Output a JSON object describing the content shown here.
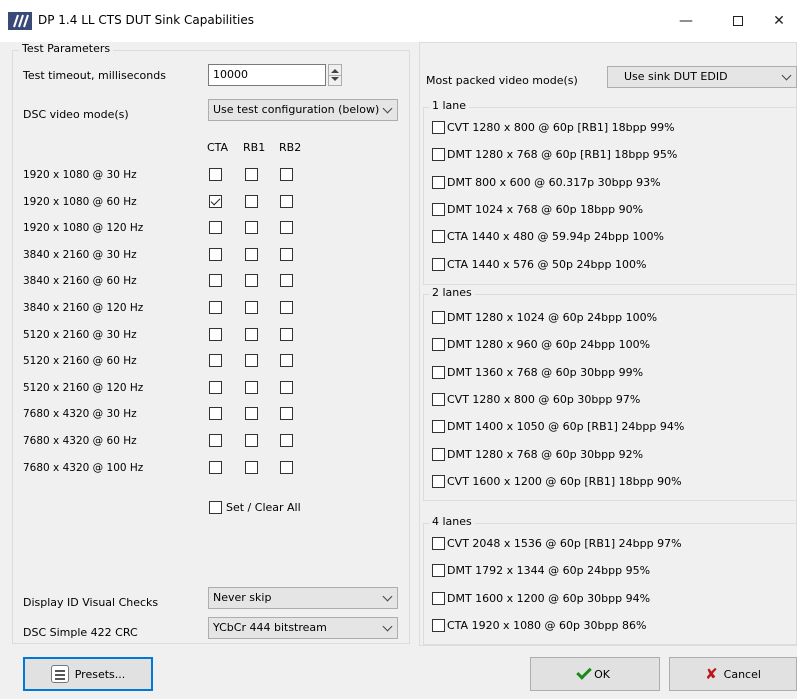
{
  "window": {
    "title": "DP 1.4 LL CTS DUT Sink Capabilities",
    "min_glyph": "—",
    "close_glyph": "✕"
  },
  "test_params": {
    "group_label": "Test Parameters",
    "timeout_label": "Test timeout, milliseconds",
    "timeout_value": "10000",
    "dsc_label": "DSC video mode(s)",
    "dsc_value": "Use test configuration (below)",
    "col_headers": [
      "CTA",
      "RB1",
      "RB2"
    ],
    "rows": [
      {
        "label": "1920 x 1080 @ 30 Hz",
        "checks": [
          false,
          false,
          false
        ]
      },
      {
        "label": "1920 x 1080 @ 60 Hz",
        "checks": [
          true,
          false,
          false
        ]
      },
      {
        "label": "1920 x 1080 @ 120 Hz",
        "checks": [
          false,
          false,
          false
        ]
      },
      {
        "label": "3840 x 2160 @ 30 Hz",
        "checks": [
          false,
          false,
          false
        ]
      },
      {
        "label": "3840 x 2160 @ 60 Hz",
        "checks": [
          false,
          false,
          false
        ]
      },
      {
        "label": "3840 x 2160 @ 120 Hz",
        "checks": [
          false,
          false,
          false
        ]
      },
      {
        "label": "5120 x 2160 @ 30 Hz",
        "checks": [
          false,
          false,
          false
        ]
      },
      {
        "label": "5120 x 2160 @ 60 Hz",
        "checks": [
          false,
          false,
          false
        ]
      },
      {
        "label": "5120 x 2160 @ 120 Hz",
        "checks": [
          false,
          false,
          false
        ]
      },
      {
        "label": "7680 x 4320 @ 30 Hz",
        "checks": [
          false,
          false,
          false
        ]
      },
      {
        "label": "7680 x 4320 @ 60 Hz",
        "checks": [
          false,
          false,
          false
        ]
      },
      {
        "label": "7680 x 4320 @ 100 Hz",
        "checks": [
          false,
          false,
          false
        ]
      }
    ],
    "set_clear_all_label": "Set / Clear All",
    "display_id_label": "Display ID Visual Checks",
    "display_id_value": "Never skip",
    "dsc422_label": "DSC Simple 422 CRC",
    "dsc422_value": "YCbCr 444 bitstream"
  },
  "video_modes": {
    "packed_label": "Most packed video mode(s)",
    "packed_value": "Use sink DUT EDID",
    "groups": [
      {
        "label": "1 lane",
        "items": [
          {
            "text": "CVT 1280 x 800 @ 60p [RB1] 18bpp 99%",
            "checked": false
          },
          {
            "text": "DMT 1280 x 768 @ 60p [RB1] 18bpp 95%",
            "checked": false
          },
          {
            "text": "DMT 800 x 600 @ 60.317p 30bpp 93%",
            "checked": false
          },
          {
            "text": "DMT 1024 x 768 @ 60p 18bpp 90%",
            "checked": false
          },
          {
            "text": "CTA 1440 x 480 @ 59.94p 24bpp 100%",
            "checked": false
          },
          {
            "text": "CTA 1440 x 576 @ 50p 24bpp 100%",
            "checked": false
          }
        ]
      },
      {
        "label": "2 lanes",
        "items": [
          {
            "text": "DMT 1280 x 1024 @ 60p 24bpp 100%",
            "checked": false
          },
          {
            "text": "DMT 1280 x 960 @ 60p 24bpp 100%",
            "checked": false
          },
          {
            "text": "DMT 1360 x 768 @ 60p 30bpp 99%",
            "checked": false
          },
          {
            "text": "CVT 1280 x 800 @ 60p 30bpp 97%",
            "checked": false
          },
          {
            "text": "DMT 1400 x 1050 @ 60p [RB1] 24bpp 94%",
            "checked": false
          },
          {
            "text": "DMT 1280 x 768 @ 60p 30bpp 92%",
            "checked": false
          },
          {
            "text": "CVT 1600 x 1200 @ 60p [RB1] 18bpp 90%",
            "checked": false
          }
        ]
      },
      {
        "label": "4 lanes",
        "items": [
          {
            "text": "CVT 2048 x 1536 @ 60p [RB1] 24bpp 97%",
            "checked": false
          },
          {
            "text": "DMT 1792 x 1344 @ 60p 24bpp 95%",
            "checked": false
          },
          {
            "text": "DMT 1600 x 1200 @ 60p 30bpp 94%",
            "checked": false
          },
          {
            "text": "CTA 1920 x 1080 @ 60p 30bpp 86%",
            "checked": false
          }
        ]
      }
    ]
  },
  "buttons": {
    "presets": "Presets...",
    "ok": "OK",
    "cancel": "Cancel"
  },
  "icons": {
    "app": "app-logo-icon",
    "presets": "presets-icon",
    "ok": "checkmark-icon",
    "cancel": "x-icon"
  },
  "colors": {
    "accent": "#0078d7",
    "ok_green": "#1a8a1a",
    "cancel_red": "#c0141c"
  }
}
